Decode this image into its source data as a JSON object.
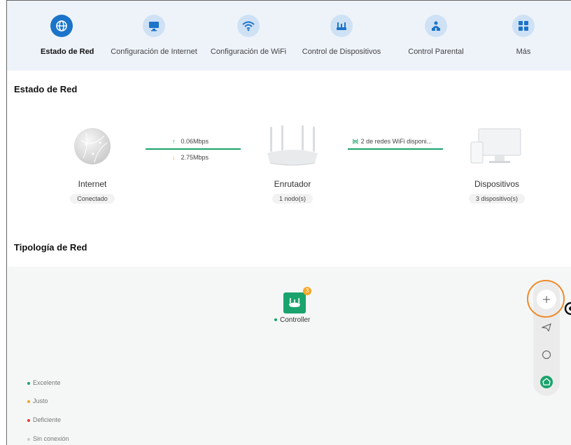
{
  "nav": {
    "items": [
      {
        "label": "Estado de Red",
        "icon": "globe-icon",
        "active": true
      },
      {
        "label": "Configuración de Internet",
        "icon": "monitor-icon",
        "active": false
      },
      {
        "label": "Configuración de WiFi",
        "icon": "wifi-icon",
        "active": false
      },
      {
        "label": "Control de Dispositivos",
        "icon": "router-icon",
        "active": false
      },
      {
        "label": "Control Parental",
        "icon": "parental-icon",
        "active": false
      },
      {
        "label": "Más",
        "icon": "grid-icon",
        "active": false
      }
    ]
  },
  "status": {
    "title": "Estado de Red",
    "internet": {
      "name": "Internet",
      "state": "Conectado"
    },
    "upload": "0.06Mbps",
    "download": "2.75Mbps",
    "router": {
      "name": "Enrutador",
      "nodes": "1 nodo(s)"
    },
    "wifi_text": "2 de redes WiFi disponi...",
    "devices": {
      "name": "Dispositivos",
      "count": "3 dispositivo(s)"
    }
  },
  "topology": {
    "title": "Tipología de Red",
    "controller_label": "Controller",
    "badge_count": "3",
    "legend": [
      "Excelente",
      "Justo",
      "Deficiente",
      "Sin conexión"
    ]
  },
  "colors": {
    "accent": "#1b74c9",
    "green": "#1aa36c",
    "orange": "#f0a22c",
    "red": "#e53935",
    "grey": "#cccccc",
    "highlight_ring": "#ef8a2d"
  }
}
